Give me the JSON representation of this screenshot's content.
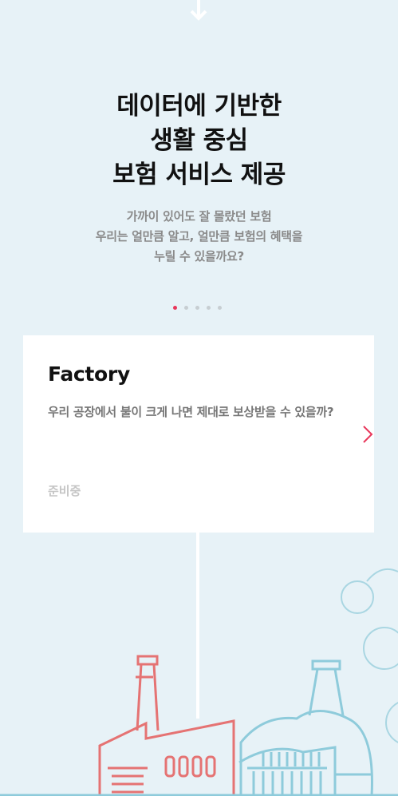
{
  "hero": {
    "title_lines": [
      "데이터에 기반한",
      "생활 중심",
      "보험 서비스 제공"
    ],
    "desc_lines": [
      "가까이 있어도 잘 몰랐던 보험",
      "우리는 얼만큼 알고, 얼만큼 보험의 혜택을",
      "누릴 수 있을까요?"
    ]
  },
  "carousel": {
    "slide_count": 5,
    "active_index": 0
  },
  "card": {
    "title": "Factory",
    "description": "우리 공장에서 불이 크게 나면 제대로 보상받을 수 있을까?",
    "status": "준비중"
  },
  "icons": {
    "top_arrow": "arrow-down-icon",
    "next": "chevron-right-icon"
  },
  "colors": {
    "background": "#e7f2f7",
    "accent": "#e8375b",
    "factory_red": "#e57373",
    "plant_blue": "#8ecbdb"
  }
}
